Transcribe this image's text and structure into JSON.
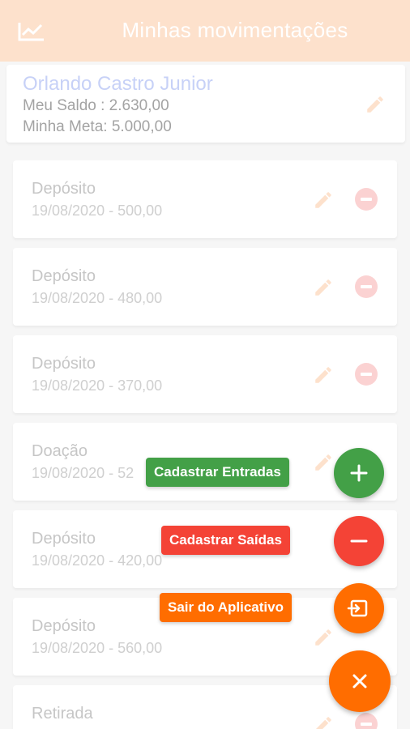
{
  "header": {
    "title": "Minhas movimentações",
    "icon": "chart-line-icon"
  },
  "profile": {
    "name": "Orlando Castro Junior",
    "balance": "Meu Saldo : 2.630,00",
    "goal": "Minha Meta: 5.000,00"
  },
  "transactions": [
    {
      "type": "Depósito",
      "detail": "19/08/2020 - 500,00"
    },
    {
      "type": "Depósito",
      "detail": "19/08/2020 - 480,00"
    },
    {
      "type": "Depósito",
      "detail": "19/08/2020 - 370,00"
    },
    {
      "type": "Doação",
      "detail": "19/08/2020 - 52"
    },
    {
      "type": "Depósito",
      "detail": "19/08/2020 - 420,00"
    },
    {
      "type": "Depósito",
      "detail": "19/08/2020 - 560,00"
    },
    {
      "type": "Retirada",
      "detail": ""
    }
  ],
  "fab_menu": {
    "entradas_label": "Cadastrar Entradas",
    "saidas_label": "Cadastrar Saídas",
    "sair_label": "Sair do Aplicativo"
  },
  "colors": {
    "header_bg": "#fde1cc",
    "green": "#43a047",
    "red": "#f44336",
    "orange": "#ff6d00"
  }
}
